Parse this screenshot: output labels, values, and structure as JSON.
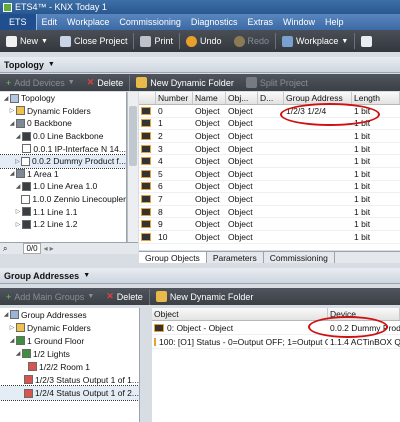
{
  "window": {
    "title": "ETS4™ - KNX Today 1"
  },
  "menu": {
    "app": "ETS",
    "items": [
      "Edit",
      "Workplace",
      "Commissioning",
      "Diagnostics",
      "Extras",
      "Window",
      "Help"
    ]
  },
  "toolbar": {
    "new": "New",
    "close_project": "Close Project",
    "print": "Print",
    "undo": "Undo",
    "redo": "Redo",
    "workplace": "Workplace"
  },
  "topology": {
    "title": "Topology",
    "add_devices": "Add Devices",
    "delete": "Delete",
    "new_dynamic_folder": "New Dynamic Folder",
    "split_project": "Split Project",
    "tree": [
      {
        "label": "Topology",
        "expander": "◢",
        "indent": 0
      },
      {
        "label": "Dynamic Folders",
        "expander": "▷",
        "indent": 1
      },
      {
        "label": "0 Backbone",
        "expander": "◢",
        "indent": 1
      },
      {
        "label": "0.0 Line Backbone",
        "expander": "◢",
        "indent": 2
      },
      {
        "label": "0.0.1  IP-Interface N 14...",
        "expander": "",
        "indent": 3
      },
      {
        "label": "0.0.2  Dummy Product f...",
        "expander": "▷",
        "indent": 2,
        "selected": true
      },
      {
        "label": "1 Area 1",
        "expander": "◢",
        "indent": 1
      },
      {
        "label": "1.0 Line Area 1.0",
        "expander": "◢",
        "indent": 2
      },
      {
        "label": "1.0.0  Zennio Linecoupler",
        "expander": "",
        "indent": 3
      },
      {
        "label": "1.1 Line 1.1",
        "expander": "▷",
        "indent": 2
      },
      {
        "label": "1.2 Line 1.2",
        "expander": "▷",
        "indent": 2
      }
    ],
    "page_input": "0/0",
    "grid": {
      "headers": [
        "Number",
        "Name",
        "Obj...",
        "D...",
        "Group Address",
        "Length"
      ],
      "rows": [
        {
          "number": "0",
          "name": "Object",
          "obj": "Object",
          "ga": "1/2/3   1/2/4",
          "length": "1 bit"
        },
        {
          "number": "1",
          "name": "Object",
          "obj": "Object",
          "ga": "",
          "length": "1 bit"
        },
        {
          "number": "2",
          "name": "Object",
          "obj": "Object",
          "ga": "",
          "length": "1 bit"
        },
        {
          "number": "3",
          "name": "Object",
          "obj": "Object",
          "ga": "",
          "length": "1 bit"
        },
        {
          "number": "4",
          "name": "Object",
          "obj": "Object",
          "ga": "",
          "length": "1 bit"
        },
        {
          "number": "5",
          "name": "Object",
          "obj": "Object",
          "ga": "",
          "length": "1 bit"
        },
        {
          "number": "6",
          "name": "Object",
          "obj": "Object",
          "ga": "",
          "length": "1 bit"
        },
        {
          "number": "7",
          "name": "Object",
          "obj": "Object",
          "ga": "",
          "length": "1 bit"
        },
        {
          "number": "8",
          "name": "Object",
          "obj": "Object",
          "ga": "",
          "length": "1 bit"
        },
        {
          "number": "9",
          "name": "Object",
          "obj": "Object",
          "ga": "",
          "length": "1 bit"
        },
        {
          "number": "10",
          "name": "Object",
          "obj": "Object",
          "ga": "",
          "length": "1 bit"
        }
      ]
    },
    "tabs": [
      "Group Objects",
      "Parameters",
      "Commissioning"
    ]
  },
  "group_addresses": {
    "title": "Group Addresses",
    "add_main_groups": "Add Main Groups",
    "delete": "Delete",
    "new_dynamic_folder": "New Dynamic Folder",
    "tree": [
      {
        "label": "Group Addresses",
        "expander": "◢",
        "indent": 0
      },
      {
        "label": "Dynamic Folders",
        "expander": "▷",
        "indent": 1
      },
      {
        "label": "1 Ground Floor",
        "expander": "◢",
        "indent": 1
      },
      {
        "label": "1/2 Lights",
        "expander": "◢",
        "indent": 2
      },
      {
        "label": "1/2/2 Room 1",
        "expander": "",
        "indent": 3
      },
      {
        "label": "1/2/3 Status Output 1 of 1...",
        "expander": "",
        "indent": 3
      },
      {
        "label": "1/2/4 Status Output 1 of 2...",
        "expander": "",
        "indent": 3,
        "selected": true
      }
    ],
    "grid": {
      "headers": [
        "Object",
        "Device"
      ],
      "rows": [
        {
          "object": "0: Object - Object",
          "device": "0.0.2  Dummy Produ..."
        },
        {
          "object": "100: [O1] Status - 0=Output OFF; 1=Output ON",
          "device": "1.1.4  ACTinBOX QUA..."
        }
      ]
    }
  },
  "colors": {
    "accent": "#2a5890",
    "annotation": "#d01010"
  }
}
